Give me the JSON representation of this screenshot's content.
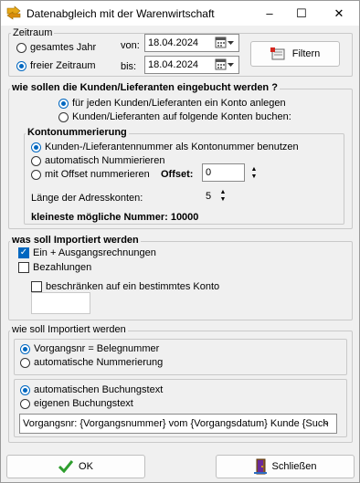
{
  "window": {
    "title": "Datenabgleich mit der Warenwirtschaft",
    "minimize": "–",
    "maximize": "☐",
    "close": "✕"
  },
  "zeitraum": {
    "label": "Zeitraum",
    "gesamtes": "gesamtes Jahr",
    "freier": "freier Zeitraum",
    "von_label": "von:",
    "von_value": "18.04.2024",
    "bis_label": "bis:",
    "bis_value": "18.04.2024",
    "filter_button": "Filtern"
  },
  "buchung": {
    "label": "wie sollen die Kunden/Lieferanten eingebucht werden ?",
    "opt1": "für jeden Kunden/Lieferanten ein Konto anlegen",
    "opt2": "Kunden/Lieferanten auf folgende Konten buchen:"
  },
  "kontonummerierung": {
    "label": "Kontonummerierung",
    "opt1": "Kunden-/Lieferantennummer als Kontonummer benutzen",
    "opt2": "automatisch Nummierieren",
    "opt3": "mit Offset nummerieren",
    "offset_label": "Offset:",
    "offset_value": "0",
    "laenge_label": "Länge der Adresskonten:",
    "laenge_value": "5",
    "kleinste_label": "kleineste mögliche Nummer: 10000"
  },
  "import1": {
    "label": "was soll Importiert werden",
    "opt1": "Ein + Ausgangsrechnungen",
    "opt2": "Bezahlungen",
    "opt3": "beschränken auf ein bestimmtes Konto",
    "konto_value": ""
  },
  "import2": {
    "label": "wie soll Importiert werden",
    "opt1": "Vorgangsnr = Belegnummer",
    "opt2": "automatische Nummerierung",
    "text_opt1": "automatischen Buchungstext",
    "text_opt2": "eigenen Buchungstext",
    "template_value": "Vorgangsnr: {Vorgangsnummer} vom {Vorgangsdatum} Kunde {Such"
  },
  "footer": {
    "ok_label": "OK",
    "close_label": "Schließen"
  },
  "colors": {
    "accent": "#0067c0",
    "ok_check": "#2e9e2e"
  }
}
